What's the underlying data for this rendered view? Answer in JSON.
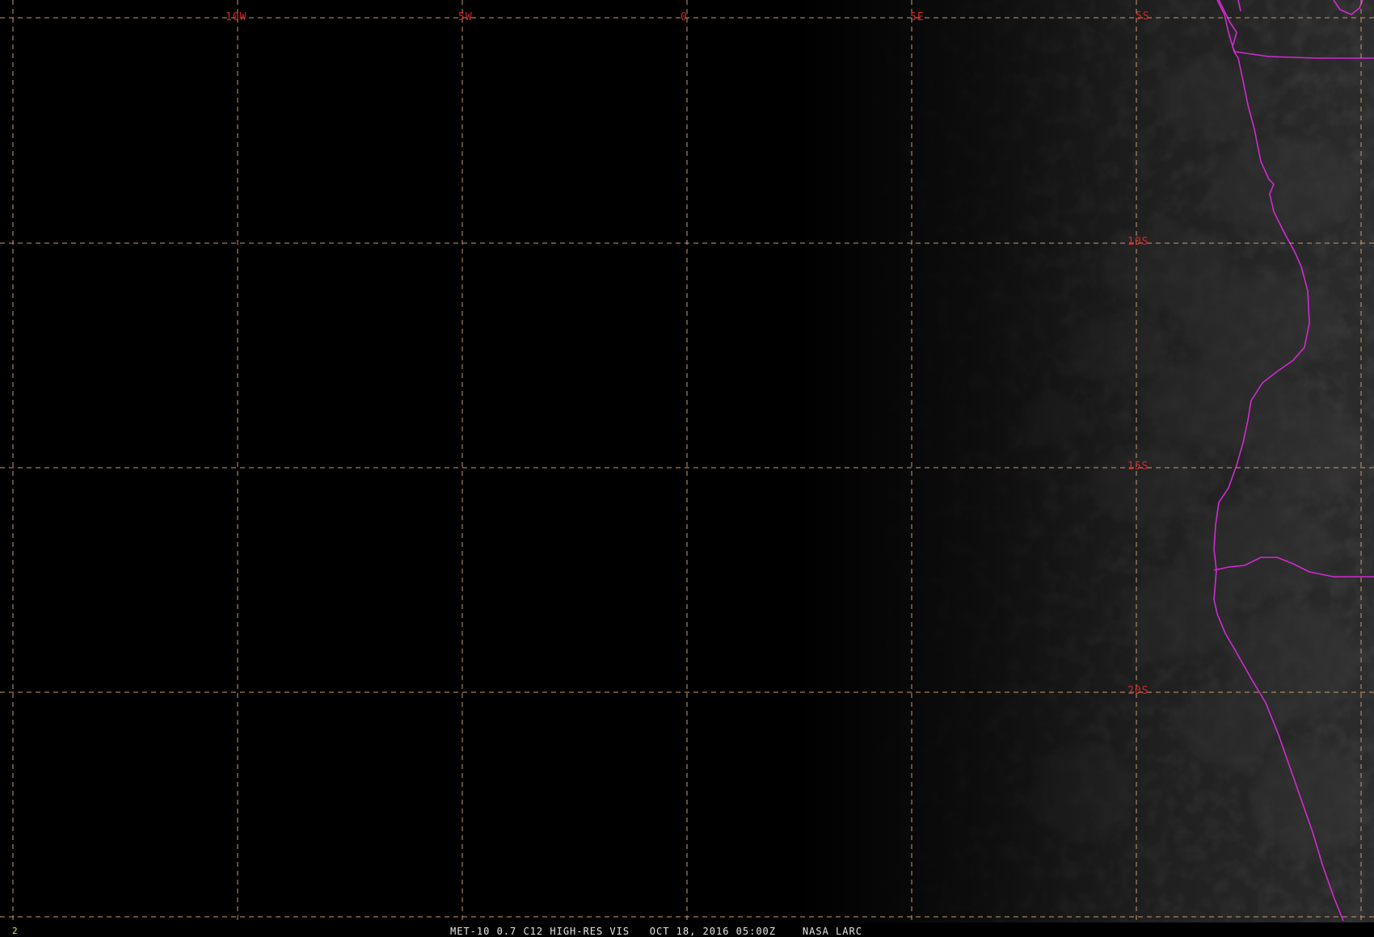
{
  "map": {
    "longitude_labels": [
      "10W",
      "5W",
      "0",
      "5E"
    ],
    "latitude_labels": [
      "5S",
      "10S",
      "15S",
      "20S"
    ],
    "colors": {
      "grid": "#c89a6e",
      "label": "#d22828",
      "borders": "#d22ad2",
      "frame_number": "#e8e832",
      "caption": "#e6e6e6"
    }
  },
  "status": {
    "frame_number": "2",
    "caption": "MET-10 0.7 C12 HIGH-RES VIS   OCT 18, 2016 05:00Z    NASA LARC"
  }
}
